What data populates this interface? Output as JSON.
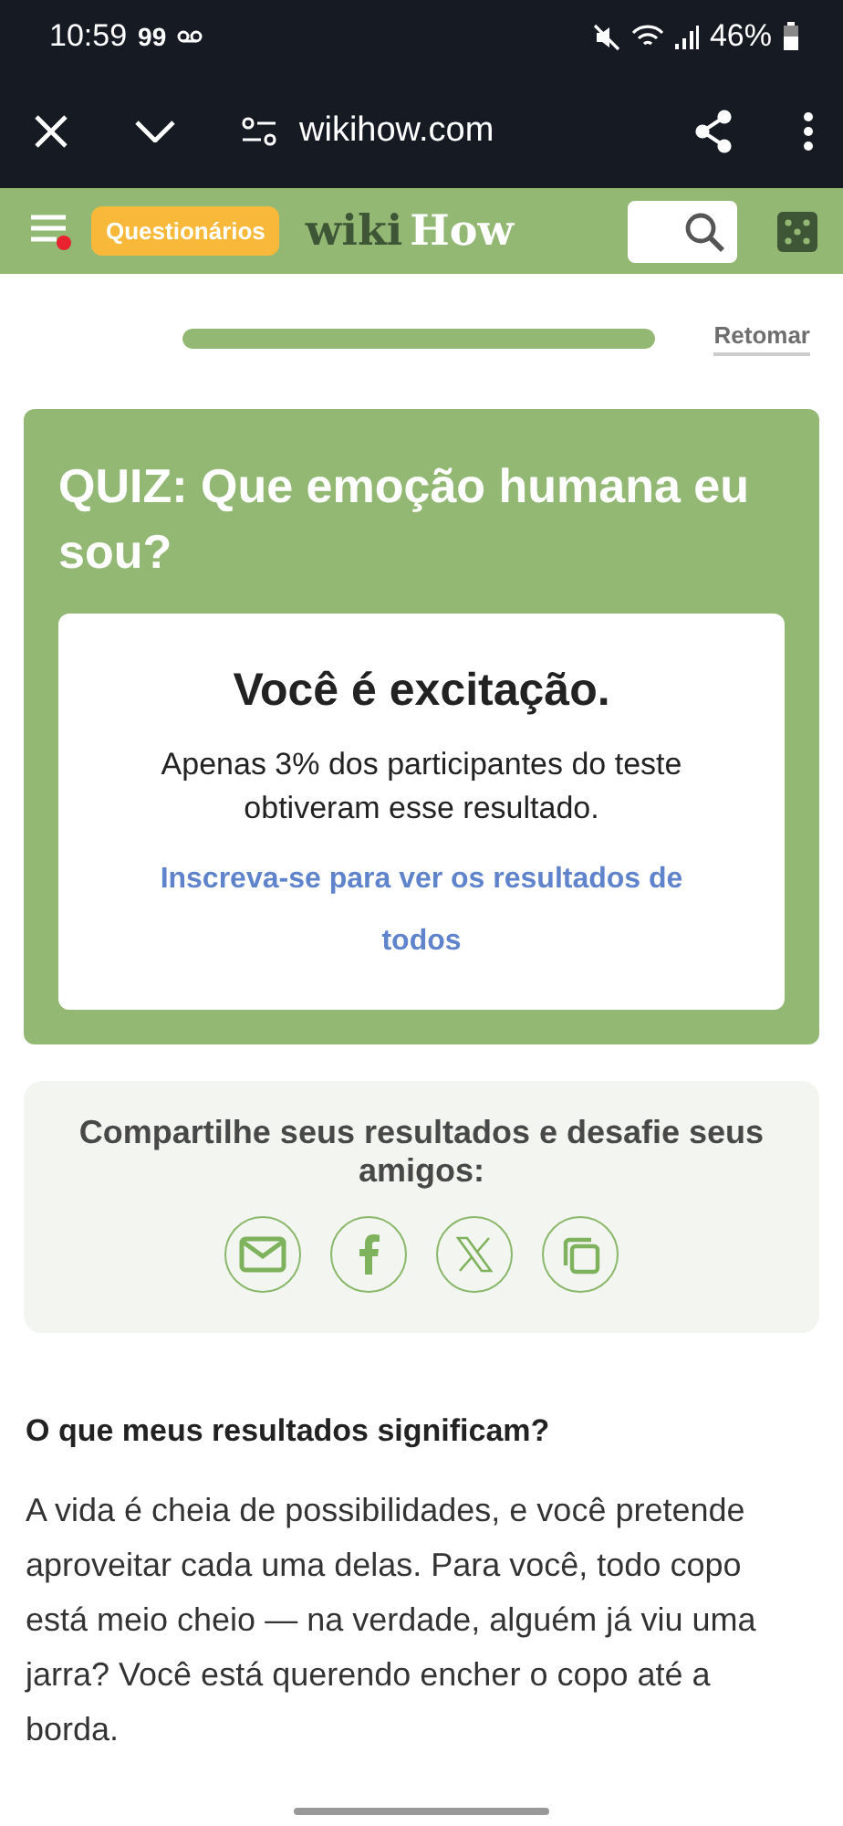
{
  "status_bar": {
    "time": "10:59",
    "notification": "99",
    "battery": "46%"
  },
  "browser_bar": {
    "url": "wikihow.com"
  },
  "header": {
    "badge": "Questionários",
    "logo_part_1": "wiki",
    "logo_part_2": "How",
    "menu_notification": true
  },
  "progress": {
    "level": 1,
    "action": "Retomar"
  },
  "quiz": {
    "title": "QUIZ: Que emoção humana eu sou?",
    "result": "Você é excitação.",
    "stat": "Apenas 3% dos participantes do teste obtiveram esse resultado.",
    "link": "Inscreva-se para ver os resultados de todos"
  },
  "share": {
    "heading": "Compartilhe seus resultados e desafie seus amigos:",
    "buttons": [
      {
        "kind": "email"
      },
      {
        "kind": "facebook"
      },
      {
        "kind": "x"
      },
      {
        "kind": "copy"
      }
    ]
  },
  "article": {
    "heading": "O que meus resultados significam?",
    "body": "A vida é cheia de possibilidades, e você pretende aproveitar cada uma delas. Para você, todo copo está meio cheio — na verdade, alguém já viu uma jarra? Você está querendo encher o copo até a borda."
  }
}
